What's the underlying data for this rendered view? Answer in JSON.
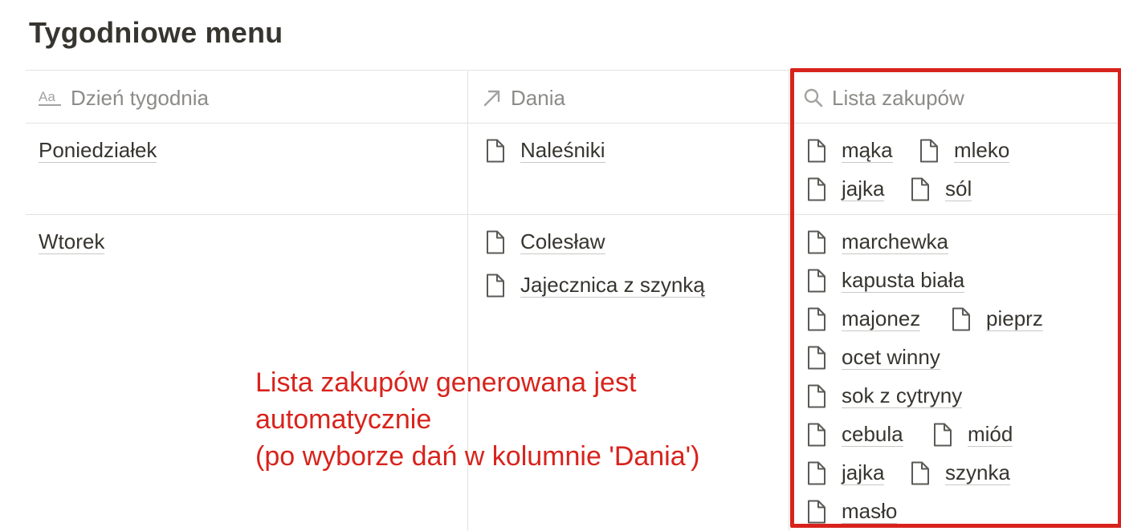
{
  "page": {
    "title": "Tygodniowe menu"
  },
  "table": {
    "columns": [
      {
        "label": "Dzień tygodnia",
        "icon": "text-property-icon"
      },
      {
        "label": "Dania",
        "icon": "relation-arrow-icon"
      },
      {
        "label": "Lista zakupów",
        "icon": "search-icon"
      }
    ],
    "rows": [
      {
        "day": "Poniedziałek",
        "dishes": [
          "Naleśniki"
        ],
        "shopping": [
          "mąka",
          "mleko",
          "jajka",
          "sól"
        ]
      },
      {
        "day": "Wtorek",
        "dishes": [
          "Colesław",
          "Jajecznica z szynką"
        ],
        "shopping": [
          "marchewka",
          "kapusta biała",
          "majonez",
          "pieprz",
          "ocet winny",
          "sok z cytryny",
          "cebula",
          "miód",
          "jajka",
          "szynka",
          "masło"
        ]
      }
    ]
  },
  "annotation": {
    "color": "#d8231c",
    "lines": [
      "Lista zakupów generowana jest",
      "automatycznie",
      "(po wyborze dań w kolumnie 'Dania')"
    ]
  }
}
